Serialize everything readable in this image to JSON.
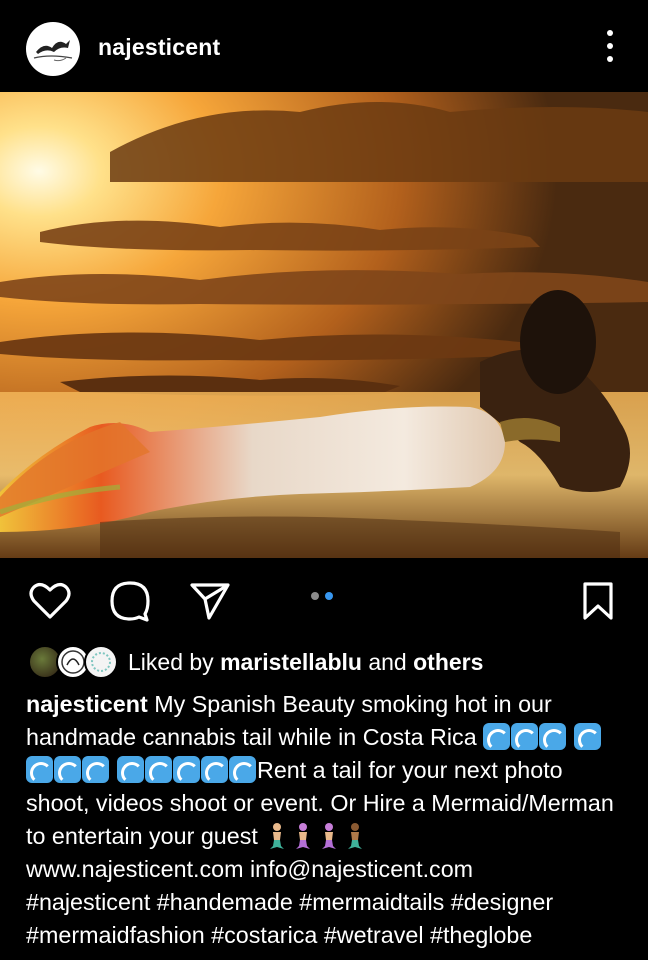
{
  "post": {
    "username": "najesticent",
    "avatar_icon": "mermaid-logo-icon"
  },
  "carousel": {
    "page_count": 2,
    "active_index": 1
  },
  "likes": {
    "prefix": "Liked by ",
    "user": "maristellablu",
    "middle": " and ",
    "others": "others"
  },
  "caption": {
    "username": "najesticent",
    "line1": "My Spanish Beauty smoking hot in our handmade cannabis tail while in Costa Rica ",
    "wave_group_1": 3,
    "wave_group_2": 4,
    "wave_group_3": 5,
    "line2": "Rent a tail for your next photo shoot, videos shoot or event. Or Hire a Mermaid/Merman to entertain your guest ",
    "line3": "www.najesticent.com info@najesticent.com",
    "hashtags_1": "#najesticent #handemade #mermaidtails #designer",
    "hashtags_2": "#mermaidfashion #costarica #wetravel #theglobe"
  },
  "colors": {
    "background": "#000000",
    "text": "#ffffff",
    "carousel_active": "#3897f0",
    "wave_emoji": "#4aa8e8"
  }
}
